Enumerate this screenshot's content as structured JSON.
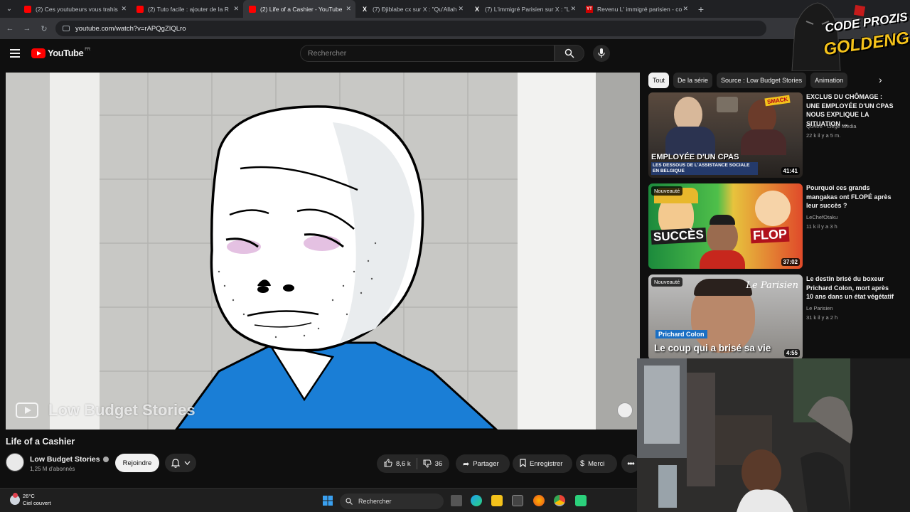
{
  "browser": {
    "tabs": [
      {
        "label": "(2) Ces youtubeurs vous trahis",
        "icon": "youtube-favicon",
        "active": false
      },
      {
        "label": "(2) Tuto facile : ajouter de la R",
        "icon": "youtube-favicon",
        "active": false
      },
      {
        "label": "(2) Life of a Cashier - YouTube",
        "icon": "youtube-favicon",
        "active": true
      },
      {
        "label": "(7) Đjiblabe cx sur X : \"Qu'Allah",
        "icon": "x-favicon",
        "active": false
      },
      {
        "label": "(7) L'immigré Parisien sur X : \"L",
        "icon": "x-favicon",
        "active": false
      },
      {
        "label": "Revenu L' immigré parisien - co",
        "icon": "yt-news-favicon",
        "active": false
      }
    ],
    "url": "youtube.com/watch?v=rAPQgZIQLro"
  },
  "youtube": {
    "logo_text": "YouTube",
    "country_code": "FR",
    "search_placeholder": "Rechercher"
  },
  "video": {
    "title": "Life of a Cashier",
    "watermark": "Low Budget Stories",
    "channel": {
      "name": "Low Budget Stories",
      "subscribers": "1,25 M d'abonnés"
    },
    "join_label": "Rejoindre",
    "likes": "8,6 k",
    "dislikes": "36",
    "share_label": "Partager",
    "save_label": "Enregistrer",
    "thanks_label": "Merci"
  },
  "chips": [
    "Tout",
    "De la série",
    "Source : Low Budget Stories",
    "Animation"
  ],
  "recommendations": [
    {
      "title": "EXCLUS DU CHÔMAGE : UNE EMPLOYÉE D'UN CPAS NOUS EXPLIQUE LA SITUATION ...",
      "channel": "Qu4tre - Liège Média",
      "meta": "22 k  il y a 5 m.",
      "duration": "41:41",
      "badge": "",
      "thumb_text": "EMPLOYÉE D'UN CPAS",
      "thumb_sub": "LES DESSOUS DE L'ASSISTANCE SOCIALE EN BELGIQUE",
      "thumb_tag": "SMACK"
    },
    {
      "title": "Pourquoi ces grands mangakas ont FLOPÉ après leur succès ?",
      "channel": "LeChefOtaku",
      "meta": "11 k  il y a 3 h",
      "duration": "37:02",
      "badge": "Nouveauté",
      "thumb_left": "SUCCÈS",
      "thumb_right": "FLOP"
    },
    {
      "title": "Le destin brisé du boxeur Prichard Colon, mort après 10 ans dans un état végétatif",
      "channel": "Le Parisien",
      "meta": "31 k  il y a 2 h",
      "duration": "4:55",
      "badge": "Nouveauté",
      "thumb_brand": "Le Parisien",
      "thumb_name": "Prichard Colon",
      "thumb_caption": "Le coup qui a brisé sa vie"
    }
  ],
  "overlay": {
    "logo_line1": "CODE PROZIS",
    "logo_line2": "GOLDENG"
  },
  "taskbar": {
    "temperature": "26°C",
    "weather": "Ciel couvert",
    "search_label": "Rechercher"
  },
  "colors": {
    "youtube_red": "#ff0000",
    "background": "#0f0f0f",
    "shirt_blue": "#1a7ed6",
    "logo_gold": "#f4c21b"
  }
}
